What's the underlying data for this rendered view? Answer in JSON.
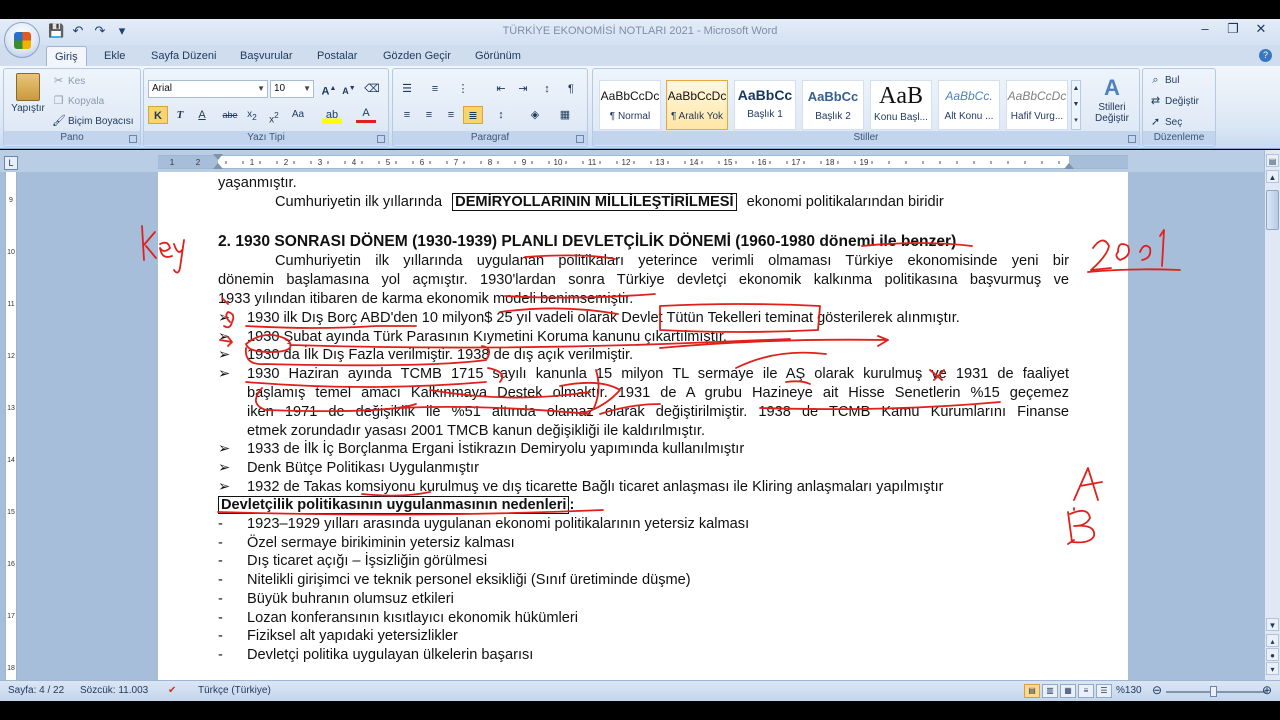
{
  "window": {
    "title": "TÜRKİYE EKONOMİSİ NOTLARI 2021  -  Microsoft Word",
    "controls": [
      "–",
      "❐",
      "✕"
    ]
  },
  "qat": {
    "save": "💾",
    "undo": "↶",
    "redo": "↷",
    "customize": "▾"
  },
  "tabs": [
    "Giriş",
    "Ekle",
    "Sayfa Düzeni",
    "Başvurular",
    "Postalar",
    "Gözden Geçir",
    "Görünüm"
  ],
  "ribbon": {
    "clipboard": {
      "paste": "Yapıştır",
      "cut": "Kes",
      "copy": "Kopyala",
      "format_painter": "Biçim Boyacısı",
      "label": "Pano"
    },
    "font": {
      "name": "Arial",
      "size": "10",
      "label": "Yazı Tipi"
    },
    "paragraph": {
      "label": "Paragraf"
    },
    "styles": {
      "label": "Stiller",
      "items": [
        {
          "sample": "AaBbCcDc",
          "name": "¶ Normal"
        },
        {
          "sample": "AaBbCcDc",
          "name": "¶ Aralık Yok"
        },
        {
          "sample": "AaBbCc",
          "name": "Başlık 1"
        },
        {
          "sample": "AaBbCc",
          "name": "Başlık 2"
        },
        {
          "sample": "AaB",
          "name": "Konu Başl..."
        },
        {
          "sample": "AaBbCc.",
          "name": "Alt Konu ..."
        },
        {
          "sample": "AaBbCcDc",
          "name": "Hafif Vurg..."
        }
      ],
      "change": "Stilleri Değiştir"
    },
    "editing": {
      "find": "Bul",
      "replace": "Değiştir",
      "select": "Seç",
      "label": "Düzenleme"
    }
  },
  "document": {
    "line0": "yaşanmıştır.",
    "line1_pre": "Cumhuriyetin  ilk  yıllarında",
    "line1_box": "DEMİRYOLLARININ MİLLİLEŞTİRİLMESİ",
    "line1_post": "ekonomi  politikalarından  biridir",
    "heading": "2. 1930 SONRASI DÖNEM (1930-1939) PLANLI DEVLETÇİLİK DÖNEMİ (1960-1980 dönemi ile benzer)",
    "para": [
      "Cumhuriyetin ilk yıllarında uygulanan politikaları yeterince verimli olmaması Türkiye ekonomisinde yeni bir",
      "dönemin başlamasına yol açmıştır. 1930'lardan sonra Türkiye devletçi ekonomik kalkınma politikasına başvurmuş ve",
      "1933 yılından itibaren de karma ekonomik modeli benimsemiştir."
    ],
    "bullets": [
      [
        "1930 ilk Dış Borç ABD'den 10 milyon$ 25 yıl vadeli olarak Devlet Tütün Tekelleri teminat gösterilerek alınmıştır."
      ],
      [
        "1930 Şubat ayında Türk Parasının Kıymetini Koruma kanunu çıkartılmıştır."
      ],
      [
        "1930 da İlk Dış Fazla verilmiştir. 1938 de dış açık verilmiştir."
      ],
      [
        "1930 Haziran ayında TCMB 1715 sayılı kanunla 15 milyon TL sermaye ile AŞ olarak kurulmuş ve 1931 de faaliyet",
        "başlamış temel amacı Kalkınmaya Destek olmaktır. 1931 de A grubu Hazineye ait Hisse Senetlerin %15 geçemez",
        "iken 1971 de değişiklik ile %51 altında olamaz olarak değiştirilmiştir. 1938 de TCMB Kamu Kurumlarını Finanse",
        "etmek zorundadır yasası 2001 TMCB kanun değişikliği ile kaldırılmıştır."
      ],
      [
        "1933 de İlk İç Borçlanma Ergani İstikrazın Demiryolu yapımında kullanılmıştır"
      ],
      [
        "Denk Bütçe Politikası Uygulanmıştır"
      ],
      [
        "1932 de Takas komsiyonu kurulmuş ve dış ticarette Bağlı ticaret anlaşması ile Kliring anlaşmaları yapılmıştır"
      ]
    ],
    "bullet_marker": "➢",
    "reasons_title": "Devletçilik politikasının uygulanmasının nedenleri",
    "reasons_colon": ":",
    "dash": "-",
    "reasons": [
      "1923–1929 yılları arasında uygulanan ekonomi politikalarının yetersiz kalması",
      "Özel sermaye birikiminin yetersiz kalması",
      "Dış ticaret açığı – İşsizliğin görülmesi",
      "Nitelikli girişimci ve teknik personel eksikliği (Sınıf üretiminde düşme)",
      "Büyük buhranın olumsuz etkileri",
      "Lozan konferansının kısıtlayıcı ekonomik hükümleri",
      "Fiziksel alt yapıdaki yetersizlikler",
      "Devletçi politika uygulayan ülkelerin başarısı"
    ]
  },
  "statusbar": {
    "page": "Sayfa: 4 / 22",
    "words": "Sözcük: 11.003",
    "language": "Türkçe (Türkiye)",
    "zoom": "%130"
  },
  "colors": {
    "ink": "#e0201a",
    "ribbon_bg": "#dbe6f4",
    "accent": "#1e395b"
  }
}
